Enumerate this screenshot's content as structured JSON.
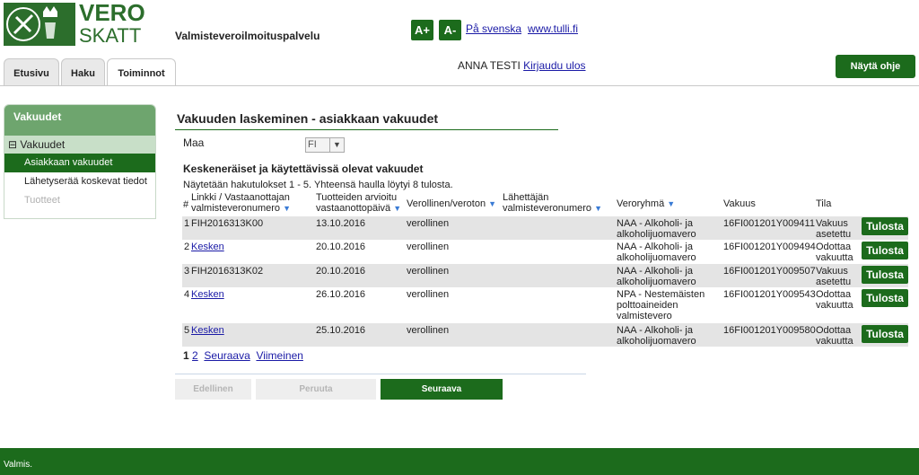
{
  "header": {
    "logo_line1": "VERO",
    "logo_line2": "SKATT",
    "service_name": "Valmisteveroilmoituspalvelu",
    "font_increase": "A+",
    "font_decrease": "A-",
    "lang_link": "På svenska",
    "site_link": "www.tulli.fi",
    "user_name": "ANNA TESTI",
    "logout": "Kirjaudu ulos",
    "help_button": "Näytä ohje"
  },
  "tabs": [
    {
      "label": "Etusivu"
    },
    {
      "label": "Haku"
    },
    {
      "label": "Toiminnot"
    }
  ],
  "sidebar": {
    "title": "Vakuudet",
    "group": "Vakuudet",
    "group_toggle": "⊟",
    "items": [
      {
        "label": "Asiakkaan vakuudet"
      },
      {
        "label": "Lähetyserää koskevat tiedot"
      },
      {
        "label": "Tuotteet"
      }
    ]
  },
  "main": {
    "title": "Vakuuden laskeminen - asiakkaan vakuudet",
    "country_label": "Maa",
    "country_value": "FI",
    "section_title": "Keskeneräiset ja käytettävissä olevat vakuudet",
    "results_info": "Näytetään hakutulokset 1 - 5. Yhteensä haulla löytyi 8 tulosta.",
    "columns": {
      "num": "#",
      "link_1": "Linkki / Vastaanottajan",
      "link_2": "valmisteveronumero",
      "date_1": "Tuotteiden arvioitu",
      "date_2": "vastaanottopäivä",
      "tax": "Verollinen/veroton",
      "sender_1": "Lähettäjän",
      "sender_2": "valmisteveronumero",
      "group": "Veroryhmä",
      "guarantee": "Vakuus",
      "status": "Tila"
    },
    "rows": [
      {
        "n": "1",
        "link": "FIH2016313K00",
        "date": "13.10.2016",
        "tax": "verollinen",
        "group_1": "NAA - Alkoholi- ja",
        "group_2": "alkoholijuomavero",
        "group_3": "",
        "guarantee": "16FI001201Y009411",
        "status_1": "Vakuus",
        "status_2": "asetettu",
        "print": "Tulosta"
      },
      {
        "n": "2",
        "link": "Kesken",
        "date": "20.10.2016",
        "tax": "verollinen",
        "group_1": "NAA - Alkoholi- ja",
        "group_2": "alkoholijuomavero",
        "group_3": "",
        "guarantee": "16FI001201Y009494",
        "status_1": "Odottaa",
        "status_2": "vakuutta",
        "print": "Tulosta"
      },
      {
        "n": "3",
        "link": "FIH2016313K02",
        "date": "20.10.2016",
        "tax": "verollinen",
        "group_1": "NAA - Alkoholi- ja",
        "group_2": "alkoholijuomavero",
        "group_3": "",
        "guarantee": "16FI001201Y009507",
        "status_1": "Vakuus",
        "status_2": "asetettu",
        "print": "Tulosta"
      },
      {
        "n": "4",
        "link": "Kesken",
        "date": "26.10.2016",
        "tax": "verollinen",
        "group_1": "NPA - Nestemäisten",
        "group_2": "polttoaineiden",
        "group_3": "valmistevero",
        "guarantee": "16FI001201Y009543",
        "status_1": "Odottaa",
        "status_2": "vakuutta",
        "print": "Tulosta"
      },
      {
        "n": "5",
        "link": "Kesken",
        "date": "25.10.2016",
        "tax": "verollinen",
        "group_1": "NAA - Alkoholi- ja",
        "group_2": "alkoholijuomavero",
        "group_3": "",
        "guarantee": "16FI001201Y009580",
        "status_1": "Odottaa",
        "status_2": "vakuutta",
        "print": "Tulosta"
      }
    ],
    "pager": {
      "current": "1",
      "page2": "2",
      "next": "Seuraava",
      "last": "Viimeinen"
    },
    "buttons": {
      "previous": "Edellinen",
      "cancel": "Peruuta",
      "next": "Seuraava"
    }
  },
  "footer": {
    "status": "Valmis."
  },
  "colors": {
    "brand_green": "#1c6b1c",
    "sidebar_header": "#6ea56e",
    "row_bg": "#e4e4e4"
  }
}
